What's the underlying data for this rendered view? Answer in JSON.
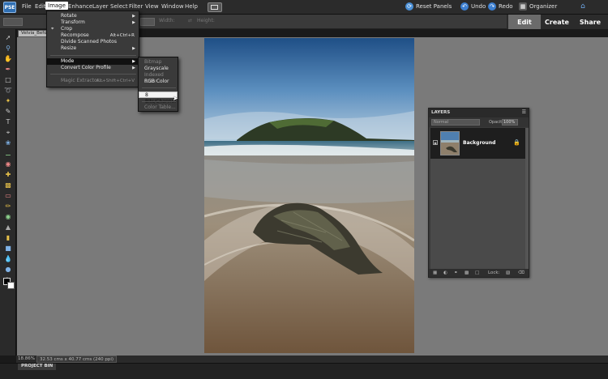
{
  "app": {
    "logo_text": "PSE"
  },
  "menubar": {
    "items": [
      "File",
      "Edit",
      "Image",
      "Enhance",
      "Layer",
      "Select",
      "Filter",
      "View",
      "Window",
      "Help"
    ],
    "reset_panels": "Reset Panels",
    "undo": "Undo",
    "redo": "Redo",
    "organizer": "Organizer"
  },
  "optionsbar": {
    "width_label": "Width:",
    "height_label": "Height:"
  },
  "mode_tabs": {
    "edit": "Edit",
    "create": "Create",
    "share": "Share"
  },
  "document": {
    "tab_label": "Velvia_Before"
  },
  "image_menu": {
    "items": [
      {
        "label": "Rotate",
        "submenu": true
      },
      {
        "label": "Transform",
        "submenu": true
      },
      {
        "label": "Crop",
        "lead_icon": "crop-icon"
      },
      {
        "label": "Recompose",
        "shortcut": "Alt+Ctrl+R"
      },
      {
        "label": "Divide Scanned Photos"
      },
      {
        "label": "Resize",
        "submenu": true
      },
      {
        "label": "Mode",
        "submenu": true,
        "highlighted": true
      },
      {
        "label": "Convert Color Profile",
        "submenu": true
      },
      {
        "label": "Magic Extractor...",
        "shortcut": "Alt+Shift+Ctrl+V",
        "disabled": true
      }
    ]
  },
  "mode_submenu": {
    "items": [
      {
        "label": "Bitmap",
        "disabled": true
      },
      {
        "label": "Grayscale"
      },
      {
        "label": "Indexed Color",
        "disabled": true
      },
      {
        "label": "RGB Color",
        "checked": true
      },
      {
        "label": "8 Bits/Channel",
        "highlighted": true
      },
      {
        "label": "Color Table...",
        "disabled": true
      }
    ]
  },
  "layers_panel": {
    "title": "LAYERS",
    "blend_mode": "Normal",
    "opacity_label": "Opacity:",
    "opacity_value": "100%",
    "layer_name": "Background",
    "lock_label": "Lock:"
  },
  "status": {
    "zoom": "18.86%",
    "doc_info": "32.53 cms x 40.77 cms (240 ppi)"
  },
  "bin": {
    "label": "PROJECT BIN"
  },
  "colors": {
    "canvas_bg": "#7a7a7a",
    "panel_bg": "#3a3a3a",
    "menu_highlight": "#111111",
    "active_tab": "#6b6b6b"
  }
}
